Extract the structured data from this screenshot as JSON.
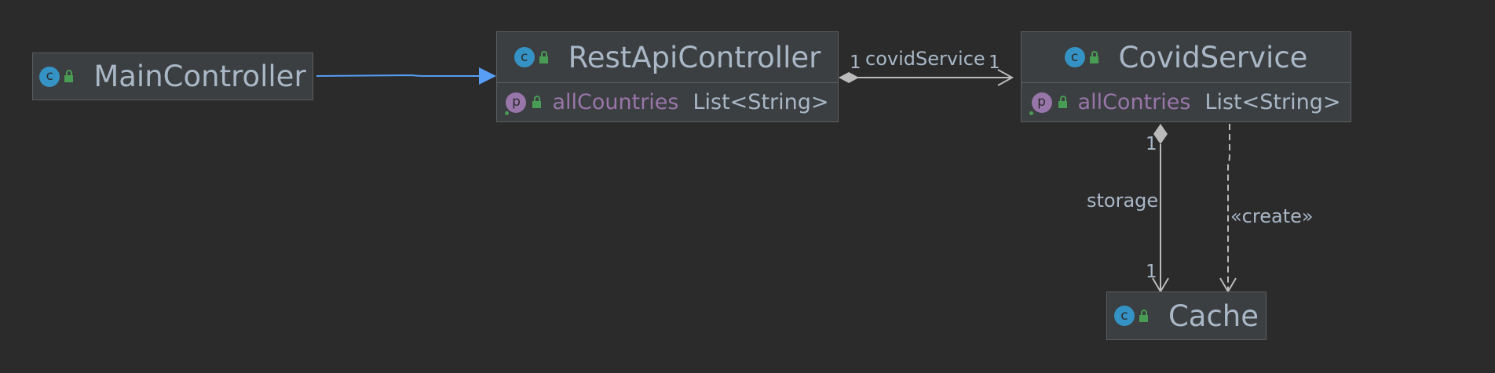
{
  "classes": {
    "main_controller": {
      "name": "MainController",
      "icon": "class-c-icon",
      "visibility_icon": "public-lock-icon"
    },
    "rest_api_controller": {
      "name": "RestApiController",
      "icon": "class-c-icon",
      "visibility_icon": "public-lock-icon",
      "fields": [
        {
          "icon": "property-p-icon",
          "name": "allCountries",
          "type": "List<String>"
        }
      ]
    },
    "covid_service": {
      "name": "CovidService",
      "icon": "class-c-icon",
      "visibility_icon": "public-lock-icon",
      "fields": [
        {
          "icon": "property-p-icon",
          "name": "allContries",
          "type": "List<String>"
        }
      ]
    },
    "cache": {
      "name": "Cache",
      "icon": "class-c-icon",
      "visibility_icon": "public-lock-icon"
    }
  },
  "icon_letters": {
    "class": "c",
    "property": "p"
  },
  "relations": {
    "covid_service_assoc": {
      "label": "covidService",
      "source_multiplicity": "1",
      "target_multiplicity": "1"
    },
    "storage_assoc": {
      "label": "storage",
      "source_multiplicity": "1",
      "target_multiplicity": "1"
    },
    "create_dependency": {
      "label": "«create»"
    }
  },
  "colors": {
    "background": "#2b2b2b",
    "class_fill": "#3c3f41",
    "class_border": "#5c5d60",
    "text": "#a9b7c6",
    "field_name": "#9876aa",
    "class_icon": "#3592c4",
    "property_icon": "#9876aa",
    "lock_icon": "#499c54",
    "inheritance_arrow": "#589df6",
    "association_line": "#bbbbbb"
  }
}
